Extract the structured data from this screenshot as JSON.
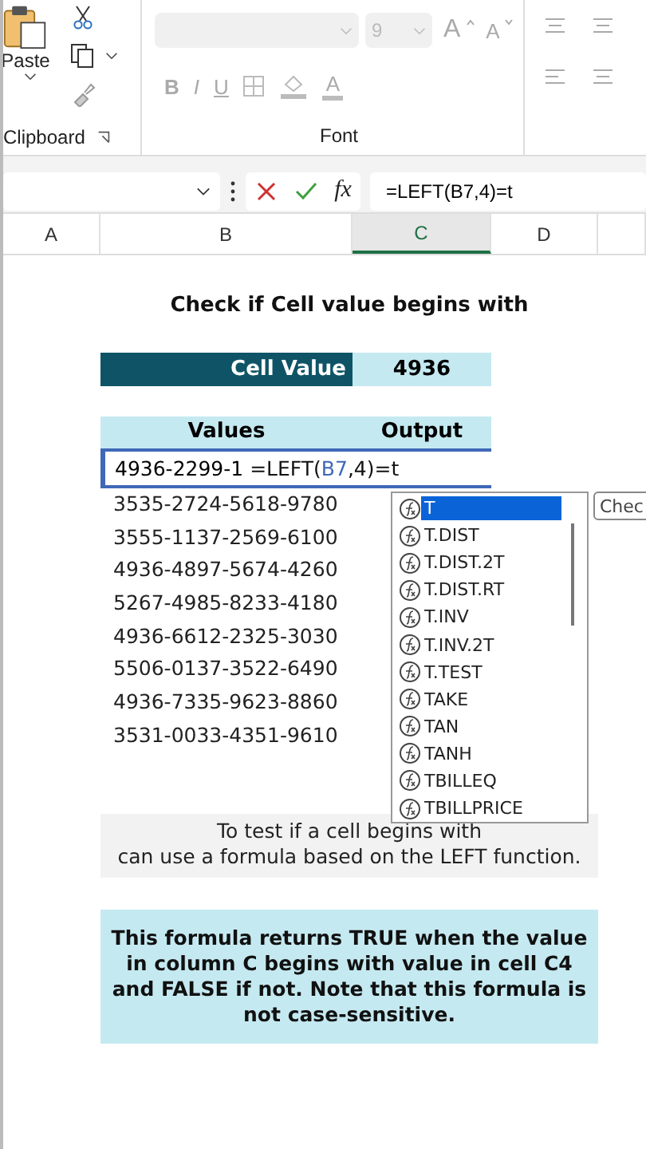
{
  "ribbon": {
    "clipboard": {
      "paste_label": "Paste",
      "group_label": "Clipboard"
    },
    "font": {
      "font_size": "9",
      "grow_label": "A",
      "shrink_label": "A",
      "format_buttons": [
        "B",
        "I",
        "U"
      ],
      "color_label": "A",
      "group_label": "Font"
    }
  },
  "formula_bar": {
    "fx_label": "fx",
    "formula": "=LEFT(B7,4)=t"
  },
  "columns": [
    {
      "label": "A",
      "selected": false
    },
    {
      "label": "B",
      "selected": false
    },
    {
      "label": "C",
      "selected": true
    },
    {
      "label": "D",
      "selected": false
    }
  ],
  "sheet": {
    "title": "Check if Cell value begins with",
    "cell_value_label": "Cell Value",
    "cell_value": "4936",
    "headers": [
      "Values",
      "Output"
    ],
    "editing_row": {
      "value": "4936-2299-1",
      "formula_start": "=LEFT(",
      "formula_ref": "B7",
      "formula_end": ",4)=t"
    },
    "values": [
      "3535-2724-5618-9780",
      "3555-1137-2569-6100",
      "4936-4897-5674-4260",
      "5267-4985-8233-4180",
      "4936-6612-2325-3030",
      "5506-0137-3522-6490",
      "4936-7335-9623-8860",
      "3531-0033-4351-9610"
    ],
    "note_lines": [
      "To test if a cell begins with",
      "can use a formula based on the LEFT function."
    ],
    "info": "This formula returns TRUE when the value in column C begins with value in cell C4 and FALSE if not. Note that this formula is not case-sensitive."
  },
  "autocomplete": {
    "items": [
      {
        "label": "T",
        "selected": true
      },
      {
        "label": "T.DIST",
        "selected": false
      },
      {
        "label": "T.DIST.2T",
        "selected": false
      },
      {
        "label": "T.DIST.RT",
        "selected": false
      },
      {
        "label": "T.INV",
        "selected": false
      },
      {
        "label": "T.INV.2T",
        "selected": false
      },
      {
        "label": "T.TEST",
        "selected": false
      },
      {
        "label": "TAKE",
        "selected": false
      },
      {
        "label": "TAN",
        "selected": false
      },
      {
        "label": "TANH",
        "selected": false
      },
      {
        "label": "TBILLEQ",
        "selected": false
      },
      {
        "label": "TBILLPRICE",
        "selected": false
      }
    ],
    "tooltip": "Chec"
  }
}
